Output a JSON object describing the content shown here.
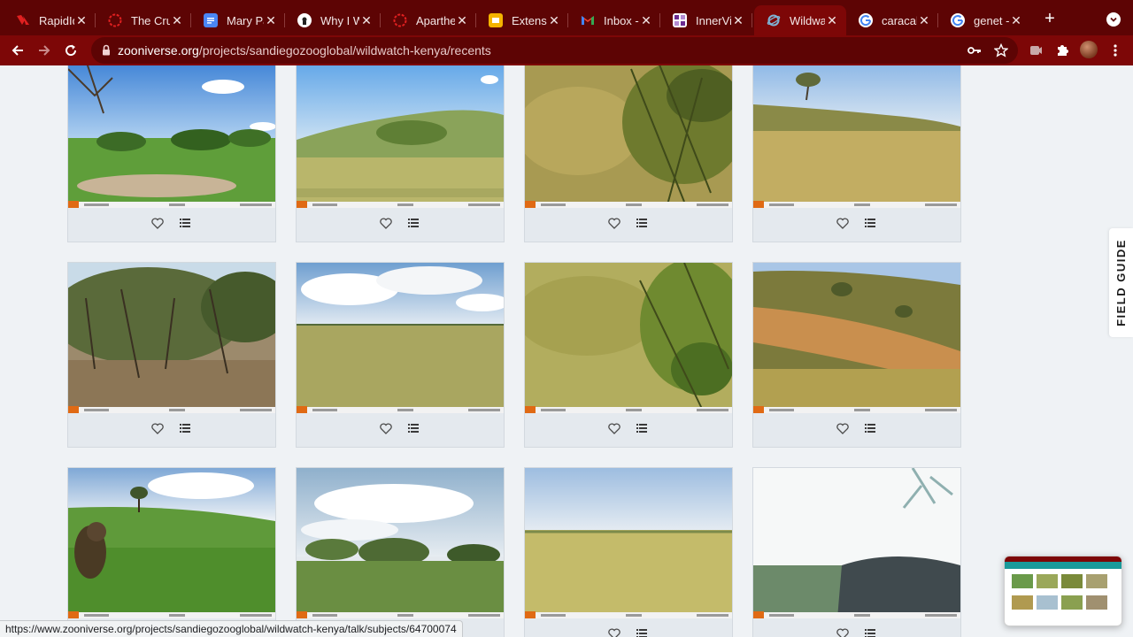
{
  "browser": {
    "tabs": [
      {
        "title": "RapidIde",
        "icon": "rapididentity-icon",
        "active": false
      },
      {
        "title": "The Cru",
        "icon": "ring-logo-icon",
        "active": false
      },
      {
        "title": "Mary Par",
        "icon": "google-docs-icon",
        "active": false
      },
      {
        "title": "Why I W",
        "icon": "medium-logo-icon",
        "active": false
      },
      {
        "title": "Apartheı",
        "icon": "ring-logo-icon",
        "active": false
      },
      {
        "title": "Extensio",
        "icon": "google-slides-icon",
        "active": false
      },
      {
        "title": "Inbox - ",
        "icon": "gmail-icon",
        "active": false
      },
      {
        "title": "InnerVie",
        "icon": "innerview-icon",
        "active": false
      },
      {
        "title": "Wildwat",
        "icon": "zooniverse-icon",
        "active": true
      },
      {
        "title": "caracal ",
        "icon": "google-icon",
        "active": false
      },
      {
        "title": "genet - ",
        "icon": "google-icon",
        "active": false
      }
    ],
    "new_tab_label": "+",
    "url_host": "zooniverse.org",
    "url_path": "/projects/sandiegozooglobal/wildwatch-kenya/recents",
    "colors": {
      "frame": "#5d0404",
      "toolbar": "#7d0707",
      "page_bg": "#eff2f5"
    }
  },
  "page": {
    "field_guide_label": "FIELD GUIDE",
    "subjects": [
      {
        "scene": "savanna-bushes",
        "favorite_label": "favorite",
        "collect_label": "add to collection"
      },
      {
        "scene": "grassy-hill",
        "favorite_label": "favorite",
        "collect_label": "add to collection"
      },
      {
        "scene": "dense-shrub",
        "favorite_label": "favorite",
        "collect_label": "add to collection"
      },
      {
        "scene": "dry-plain-tree",
        "favorite_label": "favorite",
        "collect_label": "add to collection"
      },
      {
        "scene": "thicket",
        "favorite_label": "favorite",
        "collect_label": "add to collection"
      },
      {
        "scene": "open-plain-clouds",
        "favorite_label": "favorite",
        "collect_label": "add to collection"
      },
      {
        "scene": "shrub-closeup",
        "favorite_label": "favorite",
        "collect_label": "add to collection"
      },
      {
        "scene": "hillside",
        "favorite_label": "favorite",
        "collect_label": "add to collection"
      },
      {
        "scene": "baboon-grass",
        "favorite_label": "favorite",
        "collect_label": "add to collection"
      },
      {
        "scene": "cloudy-bush",
        "favorite_label": "favorite",
        "collect_label": "add to collection"
      },
      {
        "scene": "golden-grass",
        "favorite_label": "favorite",
        "collect_label": "add to collection"
      },
      {
        "scene": "bright-glare",
        "favorite_label": "favorite",
        "collect_label": "add to collection"
      }
    ]
  },
  "status_bar": {
    "link_url": "https://www.zooniverse.org/projects/sandiegozooglobal/wildwatch-kenya/talk/subjects/64700074"
  }
}
